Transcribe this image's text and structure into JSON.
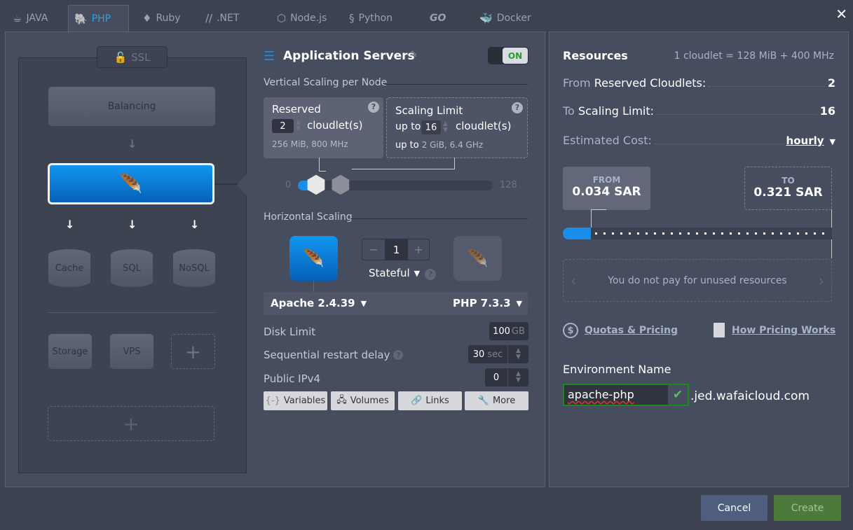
{
  "tabs": [
    {
      "label": "JAVA",
      "icon": "java-cup-icon"
    },
    {
      "label": "PHP",
      "icon": "php-elephant-icon",
      "active": true
    },
    {
      "label": "Ruby",
      "icon": "ruby-icon"
    },
    {
      "label": ".NET",
      "icon": "dotnet-icon"
    },
    {
      "label": "Node.js",
      "icon": "nodejs-icon"
    },
    {
      "label": "Python",
      "icon": "python-icon"
    },
    {
      "label": "GO",
      "icon": "go-icon"
    },
    {
      "label": "Docker",
      "icon": "docker-icon"
    }
  ],
  "topology": {
    "ssl": "SSL",
    "balancing": "Balancing",
    "cache": "Cache",
    "sql": "SQL",
    "nosql": "NoSQL",
    "storage": "Storage",
    "vps": "VPS",
    "add": "+"
  },
  "app": {
    "title": "Application Servers",
    "toggle": "ON",
    "vertical_title": "Vertical Scaling per Node",
    "reserved": {
      "title": "Reserved",
      "value": "2",
      "unit": "cloudlet(s)",
      "info": "256 MiB, 800 MHz"
    },
    "limit": {
      "title": "Scaling Limit",
      "prefix": "up to",
      "value": "16",
      "unit": "cloudlet(s)",
      "info_prefix": "up to",
      "info": "2 GiB, 6.4 GHz"
    },
    "slider": {
      "min": "0",
      "max": "128",
      "reserved": 2,
      "limit": 16
    },
    "horizontal_title": "Horizontal Scaling",
    "nodes_count": "1",
    "minus": "−",
    "plus": "+",
    "mode": "Stateful",
    "server_version": "Apache 2.4.39",
    "php_version": "PHP 7.3.3",
    "disk_label": "Disk Limit",
    "disk_value": "100",
    "disk_unit": "GB",
    "restart_label": "Sequential restart delay",
    "restart_value": "30",
    "restart_unit": "sec",
    "ipv4_label": "Public IPv4",
    "ipv4_value": "0",
    "buttons": [
      "Variables",
      "Volumes",
      "Links",
      "More"
    ]
  },
  "resources": {
    "title": "Resources",
    "cloudlet_def": "1 cloudlet = 128 MiB + 400 MHz",
    "from_prefix": "From",
    "from_label": "Reserved Cloudlets:",
    "from_value": "2",
    "to_prefix": "To",
    "to_label": "Scaling Limit:",
    "to_value": "16",
    "cost_label": "Estimated Cost:",
    "cost_period": "hourly",
    "from_price_label": "FROM",
    "from_price": "0.034 SAR",
    "to_price_label": "TO",
    "to_price": "0.321 SAR",
    "tip": "You do not pay for unused resources",
    "quotas_link": "Quotas & Pricing",
    "pricing_link": "How Pricing Works",
    "env_label": "Environment Name",
    "env_value": "apache-php",
    "env_domain": ".jed.wafaicloud.com"
  },
  "footer": {
    "cancel": "Cancel",
    "create": "Create"
  },
  "colors": {
    "accent": "#1a8de8",
    "create": "#4c7a3a",
    "cancel": "#4f5d7e",
    "valid": "#1b8a1b"
  }
}
